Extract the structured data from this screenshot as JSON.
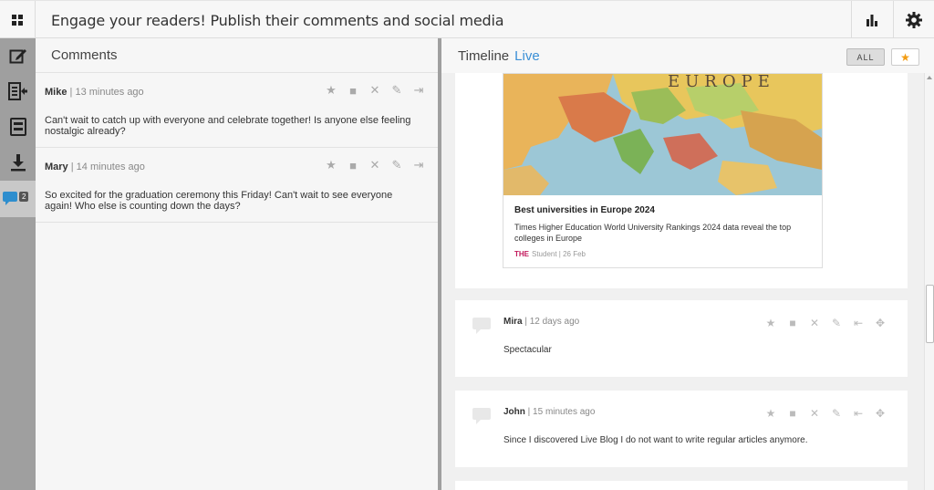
{
  "header": {
    "title": "Engage your readers! Publish their comments and social media"
  },
  "sidebar": {
    "items": [
      {
        "icon": "compose-icon"
      },
      {
        "icon": "export-icon"
      },
      {
        "icon": "list-icon"
      },
      {
        "icon": "download-icon"
      },
      {
        "icon": "comments-icon",
        "badge": "2"
      }
    ]
  },
  "comments": {
    "title": "Comments",
    "items": [
      {
        "author": "Mike",
        "time": "13 minutes ago",
        "body": "Can't wait to catch up with everyone and celebrate together! Is anyone else feeling nostalgic already?"
      },
      {
        "author": "Mary",
        "time": "14 minutes ago",
        "body": "So excited for the graduation ceremony this Friday! Can't wait to see everyone again! Who else is counting down the days?"
      }
    ]
  },
  "timeline": {
    "title": "Timeline",
    "live": "Live",
    "filter_all": "ALL",
    "filter_star": "★",
    "card": {
      "map_label": "EUROPE",
      "title": "Best universities in Europe 2024",
      "description": "Times Higher Education World University Rankings 2024 data reveal the top colleges in Europe",
      "source_logo": "THE",
      "source": "Student | 26 Feb"
    },
    "posts": [
      {
        "author": "Mira",
        "time": "12 days ago",
        "body": "Spectacular"
      },
      {
        "author": "John",
        "time": "15 minutes ago",
        "body": "Since I discovered Live Blog I do not want to write regular articles anymore."
      }
    ]
  },
  "colors": {
    "live": "#3a8fd6",
    "star": "#f39c12",
    "sidebar": "#9f9f9f"
  }
}
